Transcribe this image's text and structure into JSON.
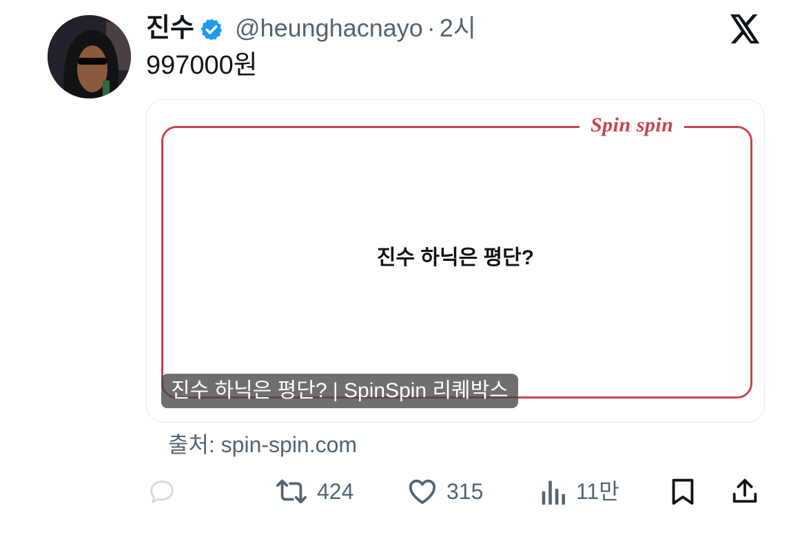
{
  "tweet": {
    "display_name": "진수",
    "handle": "@heunghacnayo",
    "separator": "·",
    "time": "2시",
    "text": "997000원"
  },
  "card": {
    "brand": "Spin spin",
    "question": "진수 하닉은 평단?",
    "caption": "진수 하닉은 평단? | SpinSpin 리퀘박스",
    "source": "출처: spin-spin.com"
  },
  "actions": {
    "retweets": "424",
    "likes": "315",
    "views": "11만"
  },
  "icons": {
    "verified": "verified-badge-icon",
    "logo": "x-logo-icon",
    "reply": "reply-icon",
    "retweet": "retweet-icon",
    "like": "heart-icon",
    "views": "views-icon",
    "bookmark": "bookmark-icon",
    "share": "share-icon"
  },
  "colors": {
    "verified_blue": "#1d9bf0",
    "card_accent": "#c8434d",
    "secondary_text": "#536471"
  }
}
